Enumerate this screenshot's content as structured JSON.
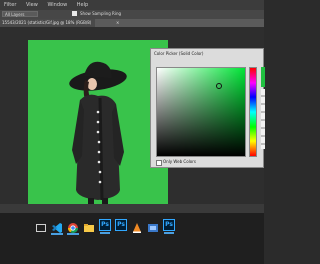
{
  "menubar": {
    "items": [
      "Filter",
      "View",
      "Window",
      "Help"
    ]
  },
  "options": {
    "sample_size": "All Layers",
    "show_sampling_ring": "Show Sampling Ring"
  },
  "document": {
    "tab_title": "15543/2021 (statistic/Gif.jpg @ 18% (RGB/8)",
    "close": "×"
  },
  "color_picker": {
    "title": "Color Picker (Solid Color)",
    "only_web_colors": "Only Web Colors",
    "current_color": "#20c040"
  },
  "taskbar": {
    "apps": [
      {
        "name": "task-view",
        "glyph": "▭"
      },
      {
        "name": "vscode",
        "glyph": "◧"
      },
      {
        "name": "chrome",
        "glyph": "◉"
      },
      {
        "name": "file-explorer",
        "glyph": "▤"
      },
      {
        "name": "photoshop",
        "glyph": "Ps"
      },
      {
        "name": "photoshop-2",
        "glyph": "Ps"
      },
      {
        "name": "vlc",
        "glyph": "▲"
      },
      {
        "name": "app-9",
        "glyph": "▦"
      },
      {
        "name": "photoshop-3",
        "glyph": "Ps"
      }
    ]
  }
}
